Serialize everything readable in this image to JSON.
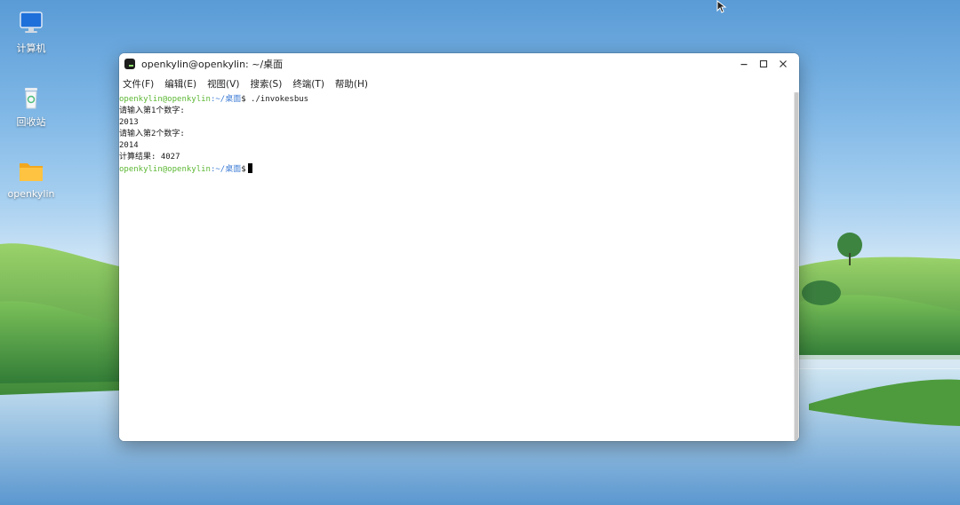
{
  "desktop": {
    "icons": [
      {
        "label": "计算机",
        "icon": "computer-icon"
      },
      {
        "label": "回收站",
        "icon": "trash-icon"
      },
      {
        "label": "openkylin",
        "icon": "folder-icon"
      }
    ]
  },
  "window": {
    "title": "openkylin@openkylin: ~/桌面",
    "controls": [
      "minimize",
      "maximize",
      "close"
    ],
    "menu": [
      "文件(F)",
      "编辑(E)",
      "视图(V)",
      "搜索(S)",
      "终端(T)",
      "帮助(H)"
    ]
  },
  "terminal": {
    "prompt_user": "openkylin@openkylin",
    "prompt_path": ":~/桌面",
    "prompt_symbol": "$",
    "command": " ./invokesbus",
    "output": [
      "请输入第1个数字:",
      "2013",
      "请输入第2个数字:",
      "2014",
      "计算结果: 4027"
    ]
  },
  "colors": {
    "prompt_user": "#5bb732",
    "prompt_path": "#3c7bd4"
  }
}
